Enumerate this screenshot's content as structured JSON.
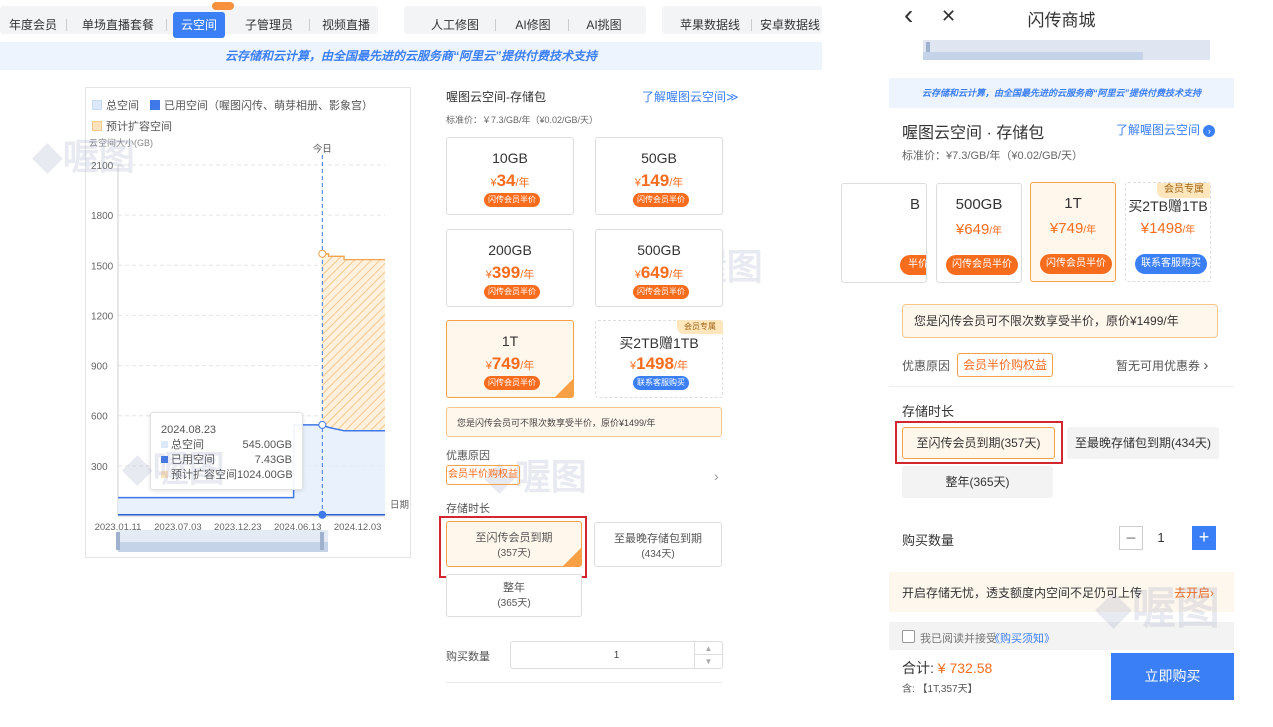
{
  "desktop": {
    "tabs_group1": [
      "年度会员",
      "单场直播套餐",
      "云空间",
      "子管理员",
      "视频直播"
    ],
    "tabs_group2": [
      "人工修图",
      "AI修图",
      "AI挑图"
    ],
    "tabs_group3": [
      "苹果数据线",
      "安卓数据线"
    ],
    "banner": "云存储和云计算，由全国最先进的云服务商“阿里云”提供付费技术支持",
    "watermark": "喔图",
    "chart_legend": {
      "total": "总空间",
      "used": "已用空间（喔图闪传、萌芽相册、影象宫）",
      "expand": "预计扩容空间"
    },
    "chart_tooltip": {
      "date": "2024.08.23",
      "rows": [
        {
          "label": "总空间",
          "value": "545.00GB"
        },
        {
          "label": "已用空间",
          "value": "7.43GB"
        },
        {
          "label": "预计扩容空间",
          "value": "1024.00GB"
        }
      ]
    },
    "product": {
      "title": "喔图云空间-存储包",
      "link": "了解喔图云空间≫",
      "std_price": "标准价：￥7.3/GB/年（¥0.02/GB/天）",
      "cards": [
        {
          "size": "10GB",
          "currency": "¥",
          "price": "34",
          "unit": "/年",
          "badge": "闪传会员半价"
        },
        {
          "size": "50GB",
          "currency": "¥",
          "price": "149",
          "unit": "/年",
          "badge": "闪传会员半价"
        },
        {
          "size": "200GB",
          "currency": "¥",
          "price": "399",
          "unit": "/年",
          "badge": "闪传会员半价"
        },
        {
          "size": "500GB",
          "currency": "¥",
          "price": "649",
          "unit": "/年",
          "badge": "闪传会员半价"
        },
        {
          "size": "1T",
          "currency": "¥",
          "price": "749",
          "unit": "/年",
          "badge": "闪传会员半价"
        },
        {
          "size": "买2TB赠1TB",
          "currency": "¥",
          "price": "1498",
          "unit": "/年",
          "badge": "联系客服购买",
          "vip": "会员专属"
        }
      ],
      "note": "您是闪传会员可不限次数享受半价，原价¥1499/年",
      "discount_label": "优惠原因",
      "discount_tag": "会员半价购权益",
      "chevron": "›",
      "duration_label": "存储时长",
      "durations": [
        {
          "title": "至闪传会员到期",
          "days": "(357天)"
        },
        {
          "title": "至最晚存储包到期",
          "days": "(434天)"
        },
        {
          "title": "整年",
          "days": "(365天)"
        }
      ],
      "qty_label": "购买数量",
      "qty": "1"
    }
  },
  "chart_data": {
    "type": "line",
    "ylabel": "云空间大小(GB)",
    "xlabel": "日期",
    "y_ticks": [
      300,
      600,
      900,
      1200,
      1500,
      1800,
      2100
    ],
    "ylim": [
      0,
      2100
    ],
    "x_ticks": [
      "2023.01.11",
      "2023.07.03",
      "2023.12.23",
      "2024.06.13",
      "2024.12.03"
    ],
    "xlim": [
      "2023.01.11",
      "2025.02.20"
    ],
    "today_label": "今日",
    "today_date": "2024.08.23",
    "series": [
      {
        "name": "总空间",
        "x": [
          "2023.01.11",
          "2024.06.01",
          "2024.06.02",
          "2024.08.23",
          "2024.09.10",
          "2024.10.25",
          "2025.02.20"
        ],
        "y": [
          110,
          110,
          545,
          545,
          530,
          510,
          510
        ]
      },
      {
        "name": "已用空间",
        "x": [
          "2023.01.11",
          "2024.06.13",
          "2024.08.23",
          "2025.02.20"
        ],
        "y": [
          7.43,
          7.43,
          7.43,
          7.43
        ]
      },
      {
        "name": "预计扩容空间",
        "x": [
          "2024.08.23",
          "2024.09.10",
          "2024.10.25",
          "2025.02.20"
        ],
        "y": [
          1569,
          1554,
          1534,
          1534
        ]
      }
    ],
    "legend_position": "top-left",
    "grid": true
  },
  "mobile": {
    "back": "‹",
    "close": "✕",
    "title": "闪传商城",
    "banner": "云存储和云计算，由全国最先进的云服务商“阿里云”提供付费技术支持",
    "product_title": "喔图云空间 · 存储包",
    "product_link": "了解喔图云空间",
    "std_price": "标准价：¥7.3/GB/年（¥0.02/GB/天）",
    "cards": [
      {
        "size": "B",
        "price": "",
        "unit": "",
        "badge": "半价"
      },
      {
        "size": "500GB",
        "price": "¥649",
        "unit": "/年",
        "badge": "闪传会员半价"
      },
      {
        "size": "1T",
        "price": "¥749",
        "unit": "/年",
        "badge": "闪传会员半价"
      },
      {
        "size": "买2TB赠1TB",
        "price": "¥1498",
        "unit": "/年",
        "badge": "联系客服购买",
        "vip": "会员专属"
      }
    ],
    "note": "您是闪传会员可不限次数享受半价，原价¥1499/年",
    "discount_label": "优惠原因",
    "discount_tag": "会员半价购权益",
    "coupon": "暂无可用优惠券",
    "chevron": "›",
    "duration_label": "存储时长",
    "durations": [
      "至闪传会员到期(357天)",
      "至最晚存储包到期(434天)",
      "整年(365天)"
    ],
    "qty_label": "购买数量",
    "qty": "1",
    "minus": "−",
    "plus": "+",
    "promo": "开启存储无忧，透支额度内空间不足仍可上传",
    "promo_link": "去开启",
    "agree_prefix": "我已阅读并接受",
    "agree_link": "《购买须知》",
    "total_label": "合计:",
    "total": "¥ 732.58",
    "contains": "含: 【1T,357天】",
    "buy": "立即购买",
    "watermark": "喔图"
  }
}
